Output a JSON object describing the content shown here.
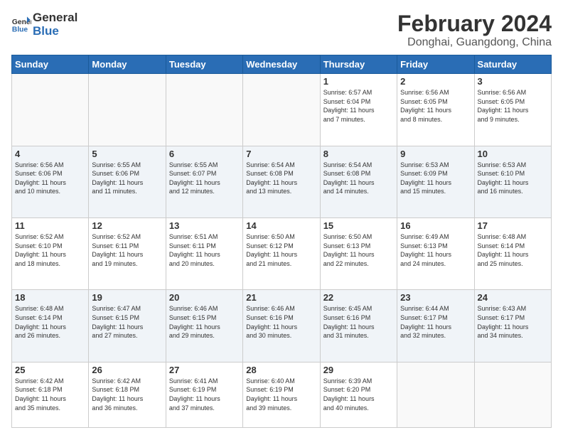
{
  "logo": {
    "line1": "General",
    "line2": "Blue"
  },
  "title": "February 2024",
  "location": "Donghai, Guangdong, China",
  "weekdays": [
    "Sunday",
    "Monday",
    "Tuesday",
    "Wednesday",
    "Thursday",
    "Friday",
    "Saturday"
  ],
  "weeks": [
    [
      {
        "day": "",
        "info": ""
      },
      {
        "day": "",
        "info": ""
      },
      {
        "day": "",
        "info": ""
      },
      {
        "day": "",
        "info": ""
      },
      {
        "day": "1",
        "info": "Sunrise: 6:57 AM\nSunset: 6:04 PM\nDaylight: 11 hours\nand 7 minutes."
      },
      {
        "day": "2",
        "info": "Sunrise: 6:56 AM\nSunset: 6:05 PM\nDaylight: 11 hours\nand 8 minutes."
      },
      {
        "day": "3",
        "info": "Sunrise: 6:56 AM\nSunset: 6:05 PM\nDaylight: 11 hours\nand 9 minutes."
      }
    ],
    [
      {
        "day": "4",
        "info": "Sunrise: 6:56 AM\nSunset: 6:06 PM\nDaylight: 11 hours\nand 10 minutes."
      },
      {
        "day": "5",
        "info": "Sunrise: 6:55 AM\nSunset: 6:06 PM\nDaylight: 11 hours\nand 11 minutes."
      },
      {
        "day": "6",
        "info": "Sunrise: 6:55 AM\nSunset: 6:07 PM\nDaylight: 11 hours\nand 12 minutes."
      },
      {
        "day": "7",
        "info": "Sunrise: 6:54 AM\nSunset: 6:08 PM\nDaylight: 11 hours\nand 13 minutes."
      },
      {
        "day": "8",
        "info": "Sunrise: 6:54 AM\nSunset: 6:08 PM\nDaylight: 11 hours\nand 14 minutes."
      },
      {
        "day": "9",
        "info": "Sunrise: 6:53 AM\nSunset: 6:09 PM\nDaylight: 11 hours\nand 15 minutes."
      },
      {
        "day": "10",
        "info": "Sunrise: 6:53 AM\nSunset: 6:10 PM\nDaylight: 11 hours\nand 16 minutes."
      }
    ],
    [
      {
        "day": "11",
        "info": "Sunrise: 6:52 AM\nSunset: 6:10 PM\nDaylight: 11 hours\nand 18 minutes."
      },
      {
        "day": "12",
        "info": "Sunrise: 6:52 AM\nSunset: 6:11 PM\nDaylight: 11 hours\nand 19 minutes."
      },
      {
        "day": "13",
        "info": "Sunrise: 6:51 AM\nSunset: 6:11 PM\nDaylight: 11 hours\nand 20 minutes."
      },
      {
        "day": "14",
        "info": "Sunrise: 6:50 AM\nSunset: 6:12 PM\nDaylight: 11 hours\nand 21 minutes."
      },
      {
        "day": "15",
        "info": "Sunrise: 6:50 AM\nSunset: 6:13 PM\nDaylight: 11 hours\nand 22 minutes."
      },
      {
        "day": "16",
        "info": "Sunrise: 6:49 AM\nSunset: 6:13 PM\nDaylight: 11 hours\nand 24 minutes."
      },
      {
        "day": "17",
        "info": "Sunrise: 6:48 AM\nSunset: 6:14 PM\nDaylight: 11 hours\nand 25 minutes."
      }
    ],
    [
      {
        "day": "18",
        "info": "Sunrise: 6:48 AM\nSunset: 6:14 PM\nDaylight: 11 hours\nand 26 minutes."
      },
      {
        "day": "19",
        "info": "Sunrise: 6:47 AM\nSunset: 6:15 PM\nDaylight: 11 hours\nand 27 minutes."
      },
      {
        "day": "20",
        "info": "Sunrise: 6:46 AM\nSunset: 6:15 PM\nDaylight: 11 hours\nand 29 minutes."
      },
      {
        "day": "21",
        "info": "Sunrise: 6:46 AM\nSunset: 6:16 PM\nDaylight: 11 hours\nand 30 minutes."
      },
      {
        "day": "22",
        "info": "Sunrise: 6:45 AM\nSunset: 6:16 PM\nDaylight: 11 hours\nand 31 minutes."
      },
      {
        "day": "23",
        "info": "Sunrise: 6:44 AM\nSunset: 6:17 PM\nDaylight: 11 hours\nand 32 minutes."
      },
      {
        "day": "24",
        "info": "Sunrise: 6:43 AM\nSunset: 6:17 PM\nDaylight: 11 hours\nand 34 minutes."
      }
    ],
    [
      {
        "day": "25",
        "info": "Sunrise: 6:42 AM\nSunset: 6:18 PM\nDaylight: 11 hours\nand 35 minutes."
      },
      {
        "day": "26",
        "info": "Sunrise: 6:42 AM\nSunset: 6:18 PM\nDaylight: 11 hours\nand 36 minutes."
      },
      {
        "day": "27",
        "info": "Sunrise: 6:41 AM\nSunset: 6:19 PM\nDaylight: 11 hours\nand 37 minutes."
      },
      {
        "day": "28",
        "info": "Sunrise: 6:40 AM\nSunset: 6:19 PM\nDaylight: 11 hours\nand 39 minutes."
      },
      {
        "day": "29",
        "info": "Sunrise: 6:39 AM\nSunset: 6:20 PM\nDaylight: 11 hours\nand 40 minutes."
      },
      {
        "day": "",
        "info": ""
      },
      {
        "day": "",
        "info": ""
      }
    ]
  ]
}
